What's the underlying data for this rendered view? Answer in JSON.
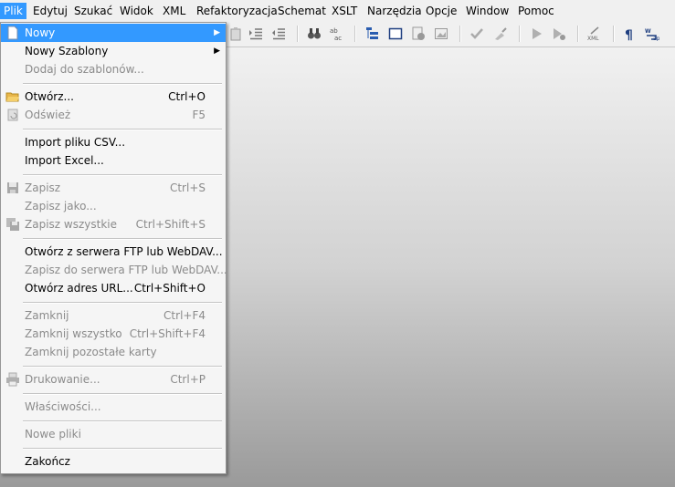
{
  "menubar": {
    "items": [
      "Plik",
      "Edytuj",
      "Szukać",
      "Widok",
      "XML",
      "Refaktoryzacja",
      "Schemat",
      "XSLT",
      "Narzędzia",
      "Opcje",
      "Window",
      "Pomoc"
    ]
  },
  "toolbar": {
    "icons": [
      "paste-icon",
      "indent-icon",
      "outdent-icon",
      "find-icon",
      "replace-icon",
      "outline-icon",
      "window-icon",
      "tag-icon",
      "image-icon",
      "check-icon",
      "clean-icon",
      "run-icon",
      "run-config-icon",
      "xml-icon",
      "paragraph-icon",
      "wrap-icon"
    ]
  },
  "file_menu": {
    "items": [
      {
        "label": "Nowy",
        "shortcut": "",
        "submenu": true,
        "enabled": true,
        "highlight": true,
        "icon": "new-file-icon"
      },
      {
        "label": "Nowy Szablony",
        "shortcut": "",
        "submenu": true,
        "enabled": true
      },
      {
        "label": "Dodaj do szablonów...",
        "shortcut": "",
        "enabled": false
      },
      {
        "label": "Otwórz...",
        "shortcut": "Ctrl+O",
        "enabled": true,
        "icon": "folder-open-icon"
      },
      {
        "label": "Odśwież",
        "shortcut": "F5",
        "enabled": false,
        "icon": "refresh-icon"
      },
      {
        "label": "Import pliku CSV...",
        "shortcut": "",
        "enabled": true
      },
      {
        "label": "Import Excel...",
        "shortcut": "",
        "enabled": true
      },
      {
        "label": "Zapisz",
        "shortcut": "Ctrl+S",
        "enabled": false,
        "icon": "save-icon"
      },
      {
        "label": "Zapisz jako...",
        "shortcut": "",
        "enabled": false
      },
      {
        "label": "Zapisz wszystkie",
        "shortcut": "Ctrl+Shift+S",
        "enabled": false,
        "icon": "save-all-icon"
      },
      {
        "label": "Otwórz z serwera FTP lub WebDAV...",
        "shortcut": "",
        "enabled": true
      },
      {
        "label": "Zapisz do serwera FTP lub WebDAV...",
        "shortcut": "",
        "enabled": false
      },
      {
        "label": "Otwórz adres URL...",
        "shortcut": "Ctrl+Shift+O",
        "enabled": true
      },
      {
        "label": "Zamknij",
        "shortcut": "Ctrl+F4",
        "enabled": false
      },
      {
        "label": "Zamknij wszystko",
        "shortcut": "Ctrl+Shift+F4",
        "enabled": false
      },
      {
        "label": "Zamknij pozostałe karty",
        "shortcut": "",
        "enabled": false
      },
      {
        "label": "Drukowanie...",
        "shortcut": "Ctrl+P",
        "enabled": false,
        "icon": "print-icon"
      },
      {
        "label": "Właściwości...",
        "shortcut": "",
        "enabled": false
      },
      {
        "label": "Nowe pliki",
        "shortcut": "",
        "enabled": false
      },
      {
        "label": "Zakończ",
        "shortcut": "",
        "enabled": true
      }
    ]
  },
  "colors": {
    "highlight": "#3399ff",
    "disabled": "#8b8b8b"
  }
}
